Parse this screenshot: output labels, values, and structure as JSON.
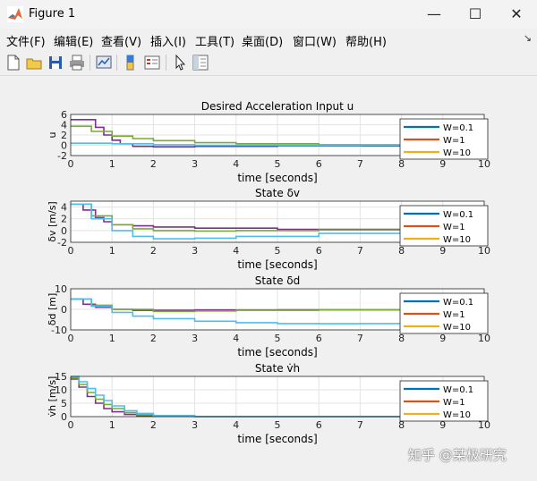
{
  "window": {
    "title": "Figure 1",
    "minimize": "—",
    "maximize": "☐",
    "close": "✕"
  },
  "menu": {
    "items": [
      "文件(F)",
      "编辑(E)",
      "查看(V)",
      "插入(I)",
      "工具(T)",
      "桌面(D)",
      "窗口(W)",
      "帮助(H)"
    ],
    "corner": "↘"
  },
  "toolbar": {
    "icons": [
      "new-figure-icon",
      "open-file-icon",
      "save-icon",
      "print-icon",
      "link-plot-icon",
      "colorbar-icon",
      "legend-icon",
      "pointer-icon",
      "property-editor-icon"
    ]
  },
  "watermark": "知乎 @某极研究",
  "colors": {
    "w01": "#0072bd",
    "w1": "#d95319",
    "w10": "#edb120",
    "purple": "#7e2f8e",
    "green": "#77ac30",
    "cyan": "#4dbeee"
  },
  "chart_data": [
    {
      "type": "line",
      "title": "Desired Acceleration Input u",
      "xlabel": "time [seconds]",
      "ylabel": "u",
      "xlim": [
        0,
        10
      ],
      "ylim": [
        -2,
        6
      ],
      "xticks": [
        "0",
        "1",
        "2",
        "3",
        "4",
        "5",
        "6",
        "7",
        "8",
        "9",
        "10"
      ],
      "yticks": [
        "6",
        "4",
        "2",
        "0",
        "-2"
      ],
      "grid": true,
      "legend_position": "right",
      "legend": [
        "W=0.1",
        "W=1",
        "W=10"
      ],
      "series": [
        {
          "color": "#7e2f8e",
          "x": [
            0,
            0.5,
            0.6,
            0.8,
            1.0,
            1.2,
            1.5,
            2,
            3,
            5,
            8,
            10
          ],
          "y": [
            5,
            5,
            3.5,
            2,
            1,
            0.3,
            -0.2,
            -0.3,
            -0.2,
            -0.1,
            0,
            0
          ]
        },
        {
          "color": "#77ac30",
          "x": [
            0,
            0.5,
            1,
            1.5,
            2,
            3,
            4,
            6,
            8,
            10
          ],
          "y": [
            3.7,
            2.7,
            1.8,
            1.3,
            0.9,
            0.5,
            0.3,
            0.1,
            0.05,
            0
          ]
        },
        {
          "color": "#4dbeee",
          "x": [
            0,
            1,
            2,
            3,
            4,
            5,
            6,
            7,
            8,
            10
          ],
          "y": [
            0.4,
            0.3,
            0.1,
            0,
            0,
            0,
            0,
            0.05,
            0.1,
            0.3
          ]
        }
      ]
    },
    {
      "type": "line",
      "title": "State δv",
      "xlabel": "time [seconds]",
      "ylabel": "δv [m/s]",
      "xlim": [
        0,
        10
      ],
      "ylim": [
        -2,
        5
      ],
      "xticks": [
        "0",
        "1",
        "2",
        "3",
        "4",
        "5",
        "6",
        "7",
        "8",
        "9",
        "10"
      ],
      "yticks": [
        "4",
        "2",
        "0",
        "-2"
      ],
      "grid": true,
      "legend_position": "right",
      "legend": [
        "W=0.1",
        "W=1",
        "W=10"
      ],
      "series": [
        {
          "color": "#7e2f8e",
          "x": [
            0,
            0.3,
            0.6,
            0.8,
            1,
            1.5,
            2,
            3,
            5,
            8,
            10
          ],
          "y": [
            4.5,
            3.5,
            2.2,
            1.5,
            1,
            0.8,
            0.6,
            0.4,
            0.2,
            0.1,
            0.1
          ]
        },
        {
          "color": "#77ac30",
          "x": [
            0,
            0.5,
            1,
            1.5,
            2,
            3,
            4,
            6,
            8,
            10
          ],
          "y": [
            4.5,
            2.5,
            1,
            0.3,
            0,
            -0.1,
            0,
            0.1,
            0.1,
            0.1
          ]
        },
        {
          "color": "#4dbeee",
          "x": [
            0,
            0.5,
            1,
            1.5,
            2,
            3,
            4,
            6,
            8,
            10
          ],
          "y": [
            4.5,
            2,
            0,
            -1,
            -1.4,
            -1.3,
            -1,
            -0.5,
            -0.2,
            0
          ]
        }
      ]
    },
    {
      "type": "line",
      "title": "State δd",
      "xlabel": "time [seconds]",
      "ylabel": "δd [m]",
      "xlim": [
        0,
        10
      ],
      "ylim": [
        -10,
        10
      ],
      "xticks": [
        "0",
        "1",
        "2",
        "3",
        "4",
        "5",
        "6",
        "7",
        "8",
        "9",
        "10"
      ],
      "yticks": [
        "10",
        "0",
        "-10"
      ],
      "grid": true,
      "legend_position": "right",
      "legend": [
        "W=0.1",
        "W=1",
        "W=10"
      ],
      "series": [
        {
          "color": "#7e2f8e",
          "x": [
            0,
            0.3,
            0.6,
            1,
            1.5,
            2,
            3,
            5,
            8,
            10
          ],
          "y": [
            5,
            2.5,
            1,
            0,
            -0.5,
            -0.5,
            -0.3,
            -0.2,
            -0.1,
            0
          ]
        },
        {
          "color": "#77ac30",
          "x": [
            0,
            0.5,
            1,
            2,
            3,
            4,
            6,
            8,
            10
          ],
          "y": [
            5,
            2,
            0,
            -1,
            -0.8,
            -0.5,
            -0.3,
            -0.1,
            0
          ]
        },
        {
          "color": "#4dbeee",
          "x": [
            0,
            0.5,
            1,
            1.5,
            2,
            3,
            4,
            5,
            6,
            7,
            8,
            10
          ],
          "y": [
            5,
            1.5,
            -1.5,
            -3.3,
            -4.5,
            -5.8,
            -6.5,
            -6.9,
            -7,
            -6.9,
            -6.5,
            -5
          ]
        }
      ]
    },
    {
      "type": "line",
      "title": "State v̇h",
      "xlabel": "time [seconds]",
      "ylabel": "v̇h [m/s]",
      "xlim": [
        0,
        10
      ],
      "ylim": [
        0,
        15
      ],
      "xticks": [
        "0",
        "1",
        "2",
        "3",
        "4",
        "5",
        "6",
        "7",
        "8",
        "9",
        "10"
      ],
      "yticks": [
        "15",
        "10",
        "5",
        "0"
      ],
      "grid": true,
      "legend_position": "right",
      "legend": [
        "W=0.1",
        "W=1",
        "W=10"
      ],
      "series": [
        {
          "color": "#7e2f8e",
          "x": [
            0,
            0.2,
            0.4,
            0.6,
            0.8,
            1,
            1.3,
            1.6,
            2,
            3,
            10
          ],
          "y": [
            14,
            11,
            7.5,
            5,
            3,
            1.8,
            0.8,
            0.3,
            0.1,
            0,
            0
          ]
        },
        {
          "color": "#77ac30",
          "x": [
            0,
            0.2,
            0.4,
            0.6,
            0.8,
            1,
            1.3,
            1.6,
            2,
            3,
            10
          ],
          "y": [
            14.5,
            12,
            9,
            6.5,
            4.5,
            3,
            1.5,
            0.7,
            0.2,
            0,
            0
          ]
        },
        {
          "color": "#4dbeee",
          "x": [
            0,
            0.2,
            0.4,
            0.6,
            0.8,
            1,
            1.3,
            1.6,
            2,
            3,
            10
          ],
          "y": [
            15,
            13,
            10.5,
            8,
            6,
            4,
            2.2,
            1.2,
            0.4,
            0,
            0
          ]
        }
      ]
    }
  ]
}
